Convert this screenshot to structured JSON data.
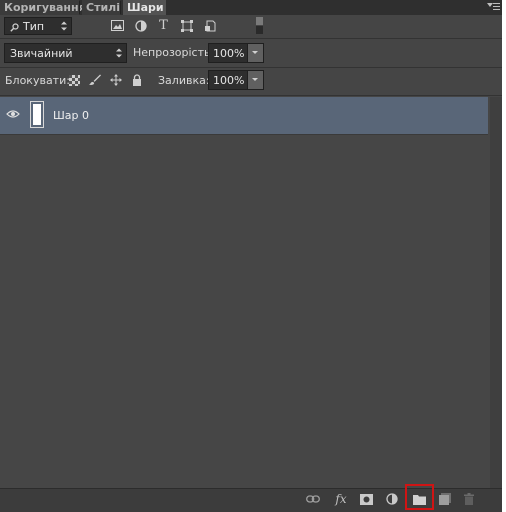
{
  "tabs": [
    {
      "label": "Коригування",
      "active": false
    },
    {
      "label": "Стилі",
      "active": false
    },
    {
      "label": "Шари",
      "active": true
    }
  ],
  "filter": {
    "kind_label": "Тип",
    "icons": [
      "pixel-layer-filter-icon",
      "adjustment-layer-filter-icon",
      "type-layer-filter-icon",
      "shape-layer-filter-icon",
      "smart-object-filter-icon"
    ]
  },
  "blend": {
    "mode": "Звичайний",
    "opacity_label": "Непрозорість:",
    "opacity_value": "100%"
  },
  "lock": {
    "label": "Блокувати:",
    "icons": [
      "lock-transparency-icon",
      "lock-image-pixels-icon",
      "lock-position-icon",
      "lock-all-icon"
    ],
    "fill_label": "Заливка:",
    "fill_value": "100%"
  },
  "layers": [
    {
      "name": "Шар 0",
      "visible": true,
      "selected": true
    }
  ],
  "bottom_icons": [
    "link-layers-icon",
    "fx-icon",
    "layer-mask-icon",
    "adjustment-layer-icon",
    "new-group-icon",
    "new-layer-icon",
    "delete-layer-icon"
  ],
  "colors": {
    "panel_bg": "#454545",
    "selected_layer_bg": "#596678",
    "highlight_border": "#d01414"
  }
}
